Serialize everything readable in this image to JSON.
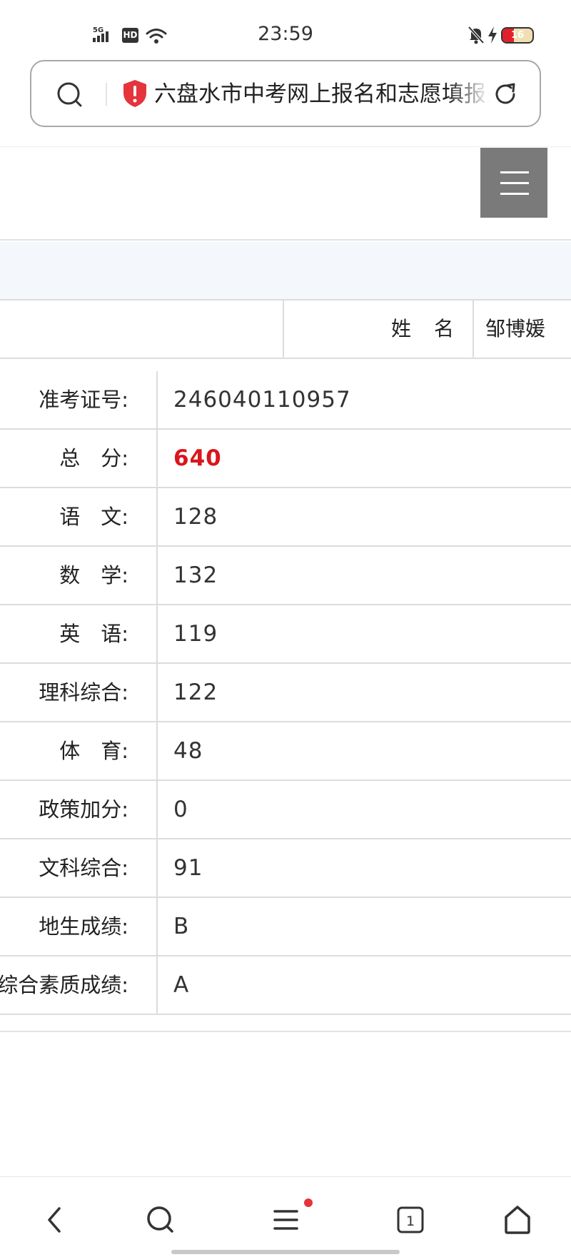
{
  "status_bar": {
    "time": "23:59",
    "network": "5G",
    "hd_badge": "HD",
    "battery_level": "16"
  },
  "browser": {
    "url_text": "六盘水市中考网上报名和志愿填报系统"
  },
  "student": {
    "name_label": "姓　名",
    "name_value": "邹博媛"
  },
  "scores": [
    {
      "label": "准考证号:",
      "value": "246040110957"
    },
    {
      "label": "总　分:",
      "value": "640"
    },
    {
      "label": "语　文:",
      "value": "128"
    },
    {
      "label": "数　学:",
      "value": "132"
    },
    {
      "label": "英　语:",
      "value": "119"
    },
    {
      "label": "理科综合:",
      "value": "122"
    },
    {
      "label": "体　育:",
      "value": "48"
    },
    {
      "label": "政策加分:",
      "value": "0"
    },
    {
      "label": "文科综合:",
      "value": "91"
    },
    {
      "label": "地生成绩:",
      "value": "B"
    },
    {
      "label": "综合素质成绩:",
      "value": "A"
    }
  ],
  "bottom_nav": {
    "tab_count": "1"
  },
  "colors": {
    "total_score": "#d9161c",
    "menu_button": "#7a7a7a",
    "shield": "#e5343b"
  }
}
